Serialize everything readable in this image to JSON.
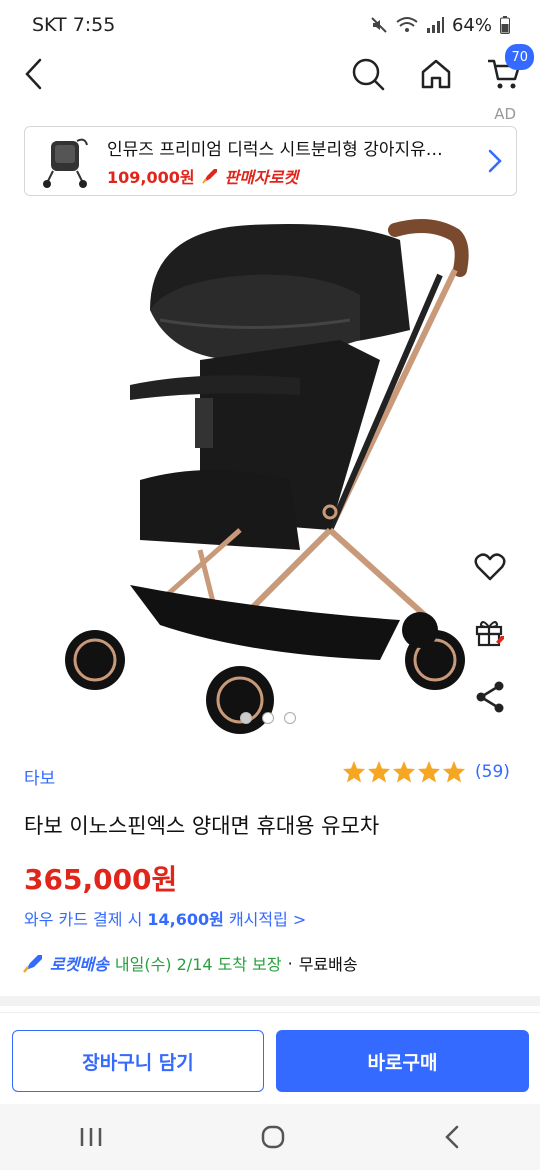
{
  "status_bar": {
    "carrier_time": "SKT 7:55",
    "battery": "64%"
  },
  "header": {
    "cart_count": "70"
  },
  "ad": {
    "label": "AD",
    "title": "인뮤즈 프리미엄 디럭스 시트분리형 강아지유…",
    "price": "109,000원",
    "badge": "판매자로켓"
  },
  "product": {
    "brand": "타보",
    "rating": 5,
    "review_count": "(59)",
    "title": "타보 이노스핀엑스 양대면 휴대용 유모차",
    "price": "365,000원",
    "cashback_prefix": "와우 카드 결제 시 ",
    "cashback_amount": "14,600원",
    "cashback_suffix": " 캐시적립 >",
    "delivery_type": "로켓배송",
    "delivery_date": "내일(수) 2/14 도착 보장",
    "delivery_separator": "·",
    "delivery_fee": "무료배송"
  },
  "gallery": {
    "total": 3,
    "active_index": 0
  },
  "actions": {
    "add_to_cart": "장바구니 담기",
    "buy_now": "바로구매"
  },
  "colors": {
    "accent": "#346aff",
    "price_red": "#e0261b",
    "delivery_green": "#26a13d",
    "star": "#f5a623"
  }
}
